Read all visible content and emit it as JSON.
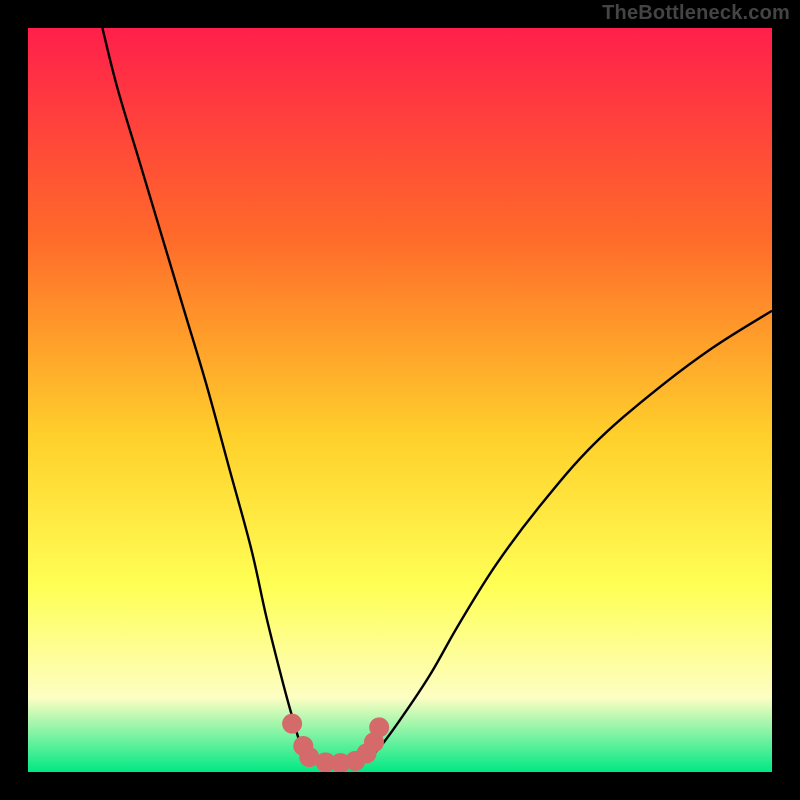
{
  "watermark": "TheBottleneck.com",
  "colors": {
    "frame_bg": "#000000",
    "grad_top": "#ff1f4b",
    "grad_mid1": "#ff6a2a",
    "grad_mid2": "#ffd02b",
    "grad_mid3": "#ffff55",
    "grad_mid4": "#fdfec3",
    "grad_bottom": "#00e884",
    "curve_stroke": "#000000",
    "marker_fill": "#d46a6a",
    "marker_stroke": "#b84d4d"
  },
  "chart_data": {
    "type": "line",
    "title": "",
    "xlabel": "",
    "ylabel": "",
    "xlim": [
      0,
      100
    ],
    "ylim": [
      0,
      100
    ],
    "grid": false,
    "series": [
      {
        "name": "left-branch",
        "x": [
          10,
          12,
          15,
          18,
          21,
          24,
          27,
          30,
          32,
          34,
          35.5,
          37
        ],
        "y": [
          100,
          92,
          82,
          72,
          62,
          52,
          41,
          30,
          21,
          13,
          7.5,
          3
        ]
      },
      {
        "name": "trough",
        "x": [
          37,
          39,
          41,
          43,
          45,
          47
        ],
        "y": [
          3,
          1.5,
          1,
          1,
          1.5,
          3
        ]
      },
      {
        "name": "right-branch",
        "x": [
          47,
          50,
          54,
          58,
          63,
          69,
          76,
          84,
          92,
          100
        ],
        "y": [
          3,
          7,
          13,
          20,
          28,
          36,
          44,
          51,
          57,
          62
        ]
      }
    ],
    "markers": {
      "name": "trough-points",
      "points": [
        {
          "x": 35.5,
          "y": 6.5
        },
        {
          "x": 37.0,
          "y": 3.5
        },
        {
          "x": 37.8,
          "y": 2.0
        },
        {
          "x": 40.0,
          "y": 1.3
        },
        {
          "x": 42.0,
          "y": 1.2
        },
        {
          "x": 44.0,
          "y": 1.5
        },
        {
          "x": 45.5,
          "y": 2.5
        },
        {
          "x": 46.5,
          "y": 4.0
        },
        {
          "x": 47.2,
          "y": 6.0
        }
      ]
    },
    "annotations": []
  }
}
